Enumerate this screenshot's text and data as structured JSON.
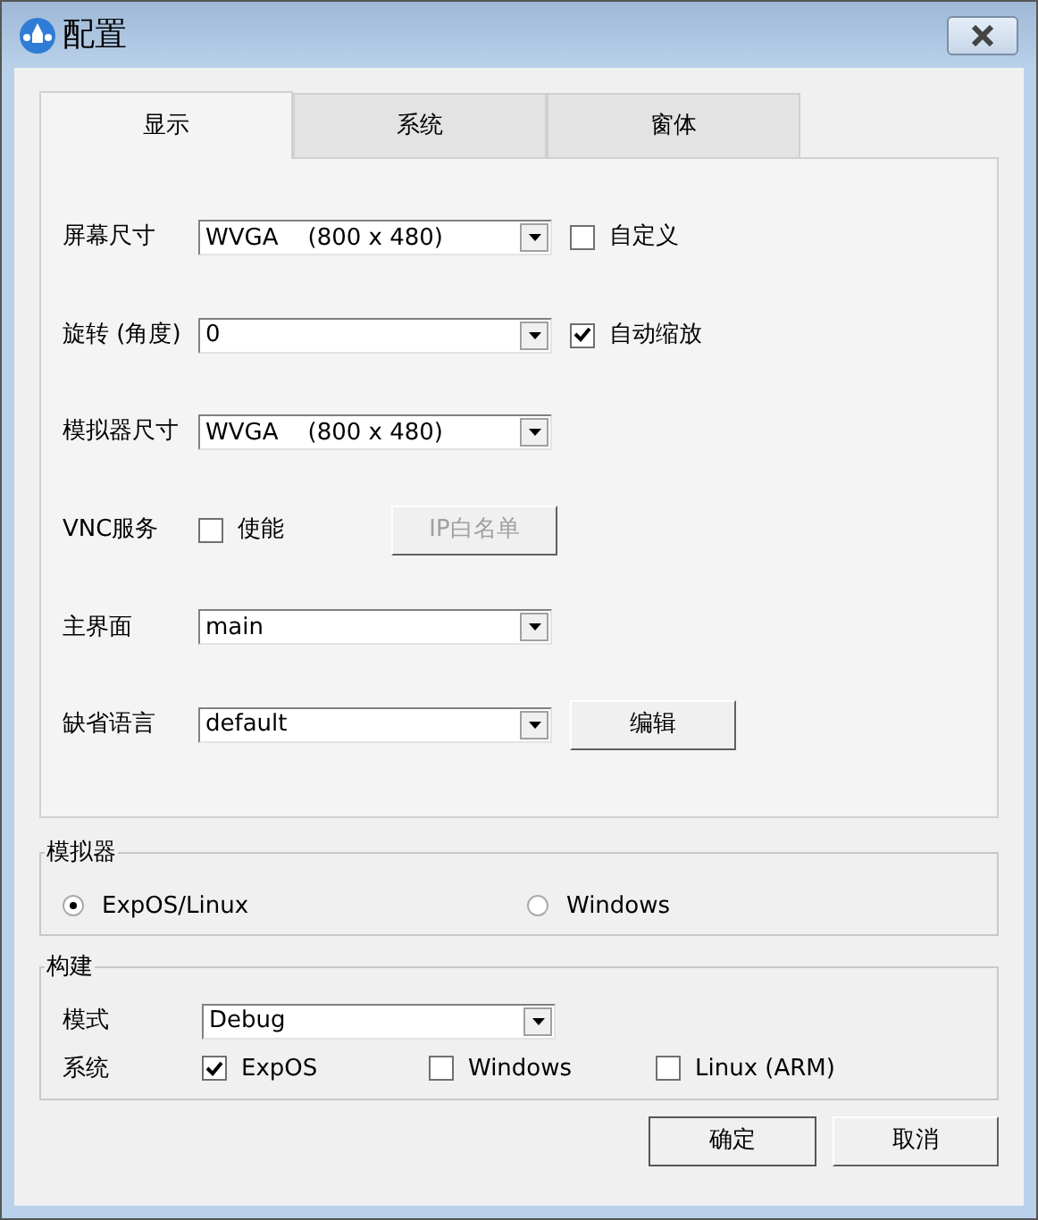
{
  "window": {
    "title": "配置"
  },
  "tabs": [
    {
      "label": "显示",
      "selected": true
    },
    {
      "label": "系统",
      "selected": false
    },
    {
      "label": "窗体",
      "selected": false
    }
  ],
  "display_rows": [
    {
      "kind": "combo",
      "label": "屏幕尺寸",
      "value": "WVGA    (800 x 480)",
      "checkbox": {
        "label": "自定义",
        "checked": false
      }
    },
    {
      "kind": "combo",
      "label": "旋转 (角度)",
      "value": "0",
      "checkbox": {
        "label": "自动缩放",
        "checked": true
      }
    },
    {
      "kind": "combo",
      "label": "模拟器尺寸",
      "value": "WVGA    (800 x 480)"
    },
    {
      "kind": "toggle",
      "label": "VNC服务",
      "checkbox": {
        "label": "使能",
        "checked": false
      },
      "button": {
        "label": "IP白名单",
        "disabled": true
      }
    },
    {
      "kind": "combo",
      "label": "主界面",
      "value": "main"
    },
    {
      "kind": "combo",
      "label": "缺省语言",
      "value": "default",
      "button": {
        "label": "编辑",
        "disabled": false
      }
    }
  ],
  "simulator": {
    "title": "模拟器",
    "options": [
      {
        "label": "ExpOS/Linux",
        "selected": true
      },
      {
        "label": "Windows",
        "selected": false
      }
    ]
  },
  "build": {
    "title": "构建",
    "mode_label": "模式",
    "mode_value": "Debug",
    "system_label": "系统",
    "systems": [
      {
        "label": "ExpOS",
        "checked": true
      },
      {
        "label": "Windows",
        "checked": false
      },
      {
        "label": "Linux (ARM)",
        "checked": false
      }
    ]
  },
  "buttons": [
    {
      "label": "确定"
    },
    {
      "label": "取消"
    }
  ]
}
